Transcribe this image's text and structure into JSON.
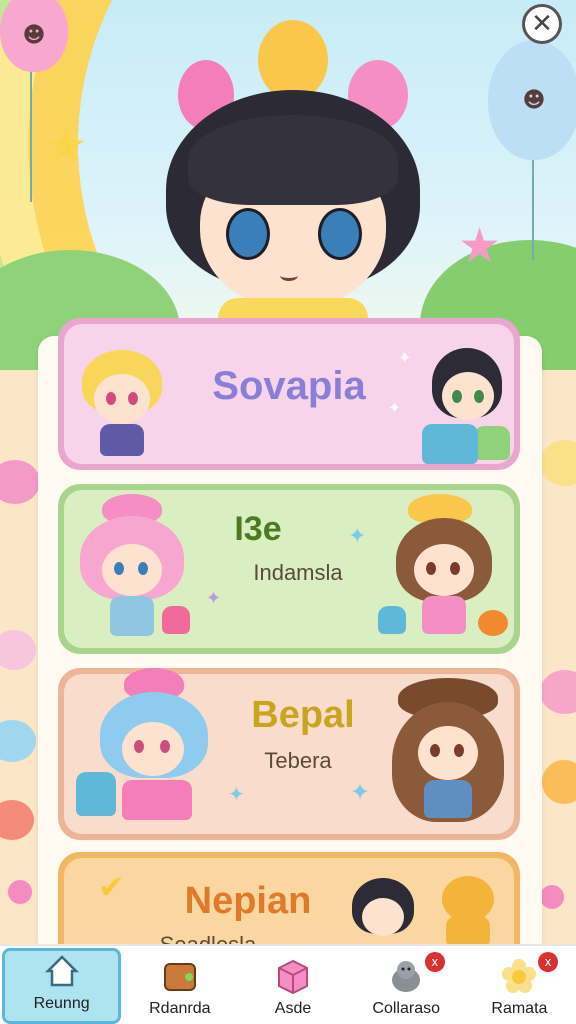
{
  "header": {
    "close_icon": "close-icon"
  },
  "cards": [
    {
      "title": "Sovapia",
      "subtitle": "",
      "bg": "#f8d4ea",
      "border": "#e9a6cf",
      "title_color": "#8a7fd6"
    },
    {
      "title": "I3e",
      "subtitle": "Indamsla",
      "bg": "#d9efc2",
      "border": "#a9d48d",
      "title_color": "#4c7a1f"
    },
    {
      "title": "Bepal",
      "subtitle": "Tebera",
      "bg": "#f9dccb",
      "border": "#ecb59a",
      "title_color": "#c9a51e"
    },
    {
      "title": "Nepian",
      "subtitle": "Seadlesla",
      "bg": "#fad7a0",
      "border": "#f0b765",
      "title_color": "#e07a2a"
    }
  ],
  "nav": [
    {
      "label": "Reunng",
      "icon": "home-icon",
      "active": true,
      "badge": ""
    },
    {
      "label": "Rdanrda",
      "icon": "wallet-icon",
      "active": false,
      "badge": ""
    },
    {
      "label": "Asde",
      "icon": "cube-icon",
      "active": false,
      "badge": ""
    },
    {
      "label": "Collaraso",
      "icon": "seal-icon",
      "active": false,
      "badge": "x"
    },
    {
      "label": "Ramata",
      "icon": "flower-icon",
      "active": false,
      "badge": "x"
    }
  ],
  "colors": {
    "accent": "#5cb7d9",
    "badge": "#d8322e"
  }
}
